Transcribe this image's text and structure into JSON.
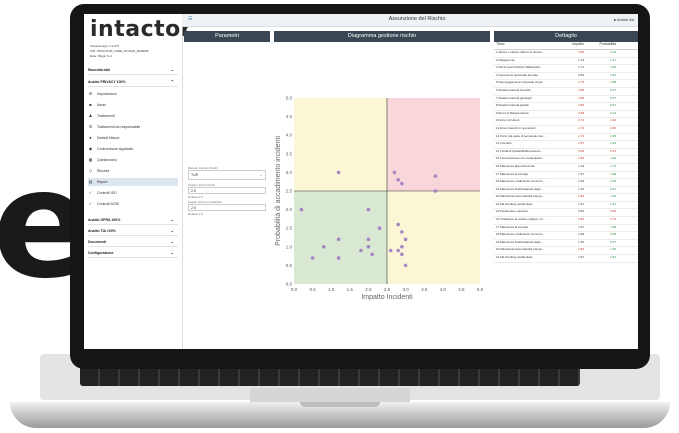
{
  "sidebar": {
    "logo": "intactor",
    "meta": [
      "Versione app: 1.0.377",
      "CID: INTACTOR_CORE_PLUGIN_2026006",
      "Ente: Plugin S.r.l."
    ],
    "sections": [
      {
        "label": "Raccolta dati"
      },
      {
        "label": "Analisi PRIVACY 100%"
      }
    ],
    "items": [
      {
        "label": "Impostazioni",
        "icon": "gear-icon"
      },
      {
        "label": "Asset",
        "icon": "cube-icon"
      },
      {
        "label": "Trattamenti",
        "icon": "people-icon"
      },
      {
        "label": "Trattamenti da responsabile",
        "icon": "user-list-icon"
      },
      {
        "label": "Default Misure",
        "icon": "circle-icon"
      },
      {
        "label": "Contromisure Applicate",
        "icon": "shield-icon"
      },
      {
        "label": "Questionario",
        "icon": "grid-icon"
      },
      {
        "label": "Rischioi",
        "icon": "diamond-icon"
      },
      {
        "label": "Report",
        "icon": "report-icon"
      },
      {
        "label": "Controlli ISO",
        "icon": "check-icon"
      },
      {
        "label": "Controlli AGID",
        "icon": "check-icon"
      }
    ],
    "bottom_sections": [
      {
        "label": "Analisi GPRA 100%"
      },
      {
        "label": "Analisi TIA 100%"
      },
      {
        "label": "Documenti"
      },
      {
        "label": "Configurazione"
      }
    ]
  },
  "topbar": {
    "title": "Assunzione del Rischio",
    "user": "Admin Ad"
  },
  "panels": {
    "parametri": "Parametri",
    "diagramma": "Diagramma gestione rischio",
    "dettaglio": "Dettaglio"
  },
  "params": {
    "metodo_label": "Metodo Calcolo Rischi",
    "metodo_value": "TUR",
    "soglia_label": "Soglia minima livello",
    "soglia_value": "2.5",
    "default_label": "Default 2.5",
    "prob_label": "Soglia minima probabilità",
    "prob_value": "2.5",
    "default2_label": "Default 2.5"
  },
  "chart_data": {
    "type": "scatter",
    "xlabel": "Impatto Incidenti",
    "ylabel": "Probabilità di accadimento incidenti",
    "xlim": [
      0,
      5
    ],
    "ylim": [
      0,
      5
    ],
    "xticks": [
      "0.0",
      "0.5",
      "1.0",
      "1.5",
      "2.0",
      "2.5",
      "3.0",
      "3.5",
      "4.0",
      "4.5",
      "5.0"
    ],
    "yticks": [
      "0.0",
      "0.5",
      "1.0",
      "1.5",
      "2.0",
      "2.5",
      "3.0",
      "3.5",
      "4.0",
      "4.5",
      "5.0"
    ],
    "threshold_x": 2.5,
    "threshold_y": 2.5,
    "quadrant_colors": {
      "bottom_left": "#d9e8d2",
      "top_left": "#fbf7d6",
      "bottom_right": "#fbf7d6",
      "top_right": "#f8d6d9"
    },
    "point_color": "#a07cc0",
    "points": [
      [
        0.2,
        2.0
      ],
      [
        1.2,
        3.0
      ],
      [
        2.7,
        3.0
      ],
      [
        2.8,
        2.8
      ],
      [
        2.9,
        2.7
      ],
      [
        3.8,
        2.9
      ],
      [
        3.8,
        2.5
      ],
      [
        2.0,
        2.0
      ],
      [
        2.3,
        1.5
      ],
      [
        2.0,
        1.2
      ],
      [
        1.2,
        1.2
      ],
      [
        0.8,
        1.0
      ],
      [
        1.8,
        0.9
      ],
      [
        1.2,
        0.7
      ],
      [
        0.5,
        0.7
      ],
      [
        2.8,
        1.6
      ],
      [
        2.9,
        1.4
      ],
      [
        3.0,
        1.2
      ],
      [
        2.9,
        1.0
      ],
      [
        2.8,
        0.9
      ],
      [
        3.0,
        0.5
      ],
      [
        2.0,
        1.0
      ],
      [
        2.1,
        0.8
      ],
      [
        2.6,
        0.9
      ],
      [
        2.9,
        0.8
      ]
    ]
  },
  "table": {
    "headers": [
      "Titolo",
      "Impatto",
      "Probabilità"
    ],
    "rows": [
      [
        "1 Abuso o cattivo utilizzo di risorse...",
        "3.80",
        "2.19",
        "#c0392b",
        "#1e8a3a"
      ],
      [
        "2 Allagamento",
        "1.19",
        "1.47",
        "#333",
        "#1e8a3a"
      ],
      [
        "3 Atti di Guerra/Azioni Militari/Atti...",
        "1.71",
        "1.26",
        "#333",
        "#1e8a3a"
      ],
      [
        "4 Carenza di personale formato",
        "0.52",
        "1.51",
        "#333",
        "#1e8a3a"
      ],
      [
        "5 Danneggiamento (da parte di per...",
        "2.75",
        "1.58",
        "#c0392b",
        "#1e8a3a"
      ],
      [
        "6 Disastri naturali climatici",
        "2.89",
        "0.97",
        "#c0392b",
        "#1e8a3a"
      ],
      [
        "7 Disastri naturali geologici",
        "2.89",
        "0.97",
        "#c0392b",
        "#1e8a3a"
      ],
      [
        "8 Disastri naturali globali",
        "2.89",
        "0.97",
        "#c0392b",
        "#1e8a3a"
      ],
      [
        "9 Errori di Manutenzione",
        "3.68",
        "2.44",
        "#c0392b",
        "#1e8a3a"
      ],
      [
        "10 Errori di Utenti",
        "2.74",
        "2.90",
        "#c0392b",
        "#c0392b"
      ],
      [
        "11 Errori trasmiti in operazioni",
        "2.79",
        "2.66",
        "#c0392b",
        "#c0392b"
      ],
      [
        "12 Furto (da parte di personale inte...",
        "2.76",
        "1.95",
        "#c0392b",
        "#1e8a3a"
      ],
      [
        "13 Incendio",
        "2.87",
        "1.94",
        "#c0392b",
        "#1e8a3a"
      ],
      [
        "14 Incidenti Quasti/Malfunzionam...",
        "3.68",
        "2.91",
        "#c0392b",
        "#c0392b"
      ],
      [
        "15 Intercettazione e/o manipolazio...",
        "2.83",
        "1.46",
        "#c0392b",
        "#1e8a3a"
      ],
      [
        "16 Mancanza alla conformita",
        "1.19",
        "1.74",
        "#333",
        "#1e8a3a"
      ],
      [
        "17 Mancanza di energia",
        "1.97",
        "1.98",
        "#333",
        "#1e8a3a"
      ],
      [
        "18 Mancanza o fallimento di comm...",
        "1.99",
        "2.25",
        "#333",
        "#1e8a3a"
      ],
      [
        "19 Mancanza finalizzata/e/a degli ...",
        "1.35",
        "0.97",
        "#333",
        "#1e8a3a"
      ],
      [
        "20 Mascheramento identità (da pa...",
        "2.83",
        "1.45",
        "#c0392b",
        "#1e8a3a"
      ],
      [
        "21 Ma finudling accidentale",
        "1.97",
        "1.51",
        "#333",
        "#1e8a3a"
      ],
      [
        "22 Pandemia e carestia",
        "0.82",
        "3.00",
        "#333",
        "#c0392b"
      ],
      [
        "23 Violazione di codice maligno / In...",
        "2.83",
        "2.76",
        "#c0392b",
        "#c0392b"
      ],
      [
        "17 Mancanza di energia",
        "1.97",
        "1.98",
        "#333",
        "#1e8a3a"
      ],
      [
        "18 Mancanza o fallimento di comm...",
        "1.99",
        "2.25",
        "#333",
        "#1e8a3a"
      ],
      [
        "19 Mancanza finalizzata/e/a degli ...",
        "1.35",
        "0.97",
        "#333",
        "#1e8a3a"
      ],
      [
        "20 Mascheramento identità (da pa...",
        "2.83",
        "1.45",
        "#c0392b",
        "#1e8a3a"
      ],
      [
        "21 Ma finudling accidentale",
        "1.97",
        "1.51",
        "#333",
        "#1e8a3a"
      ]
    ]
  },
  "bigletter": "e"
}
